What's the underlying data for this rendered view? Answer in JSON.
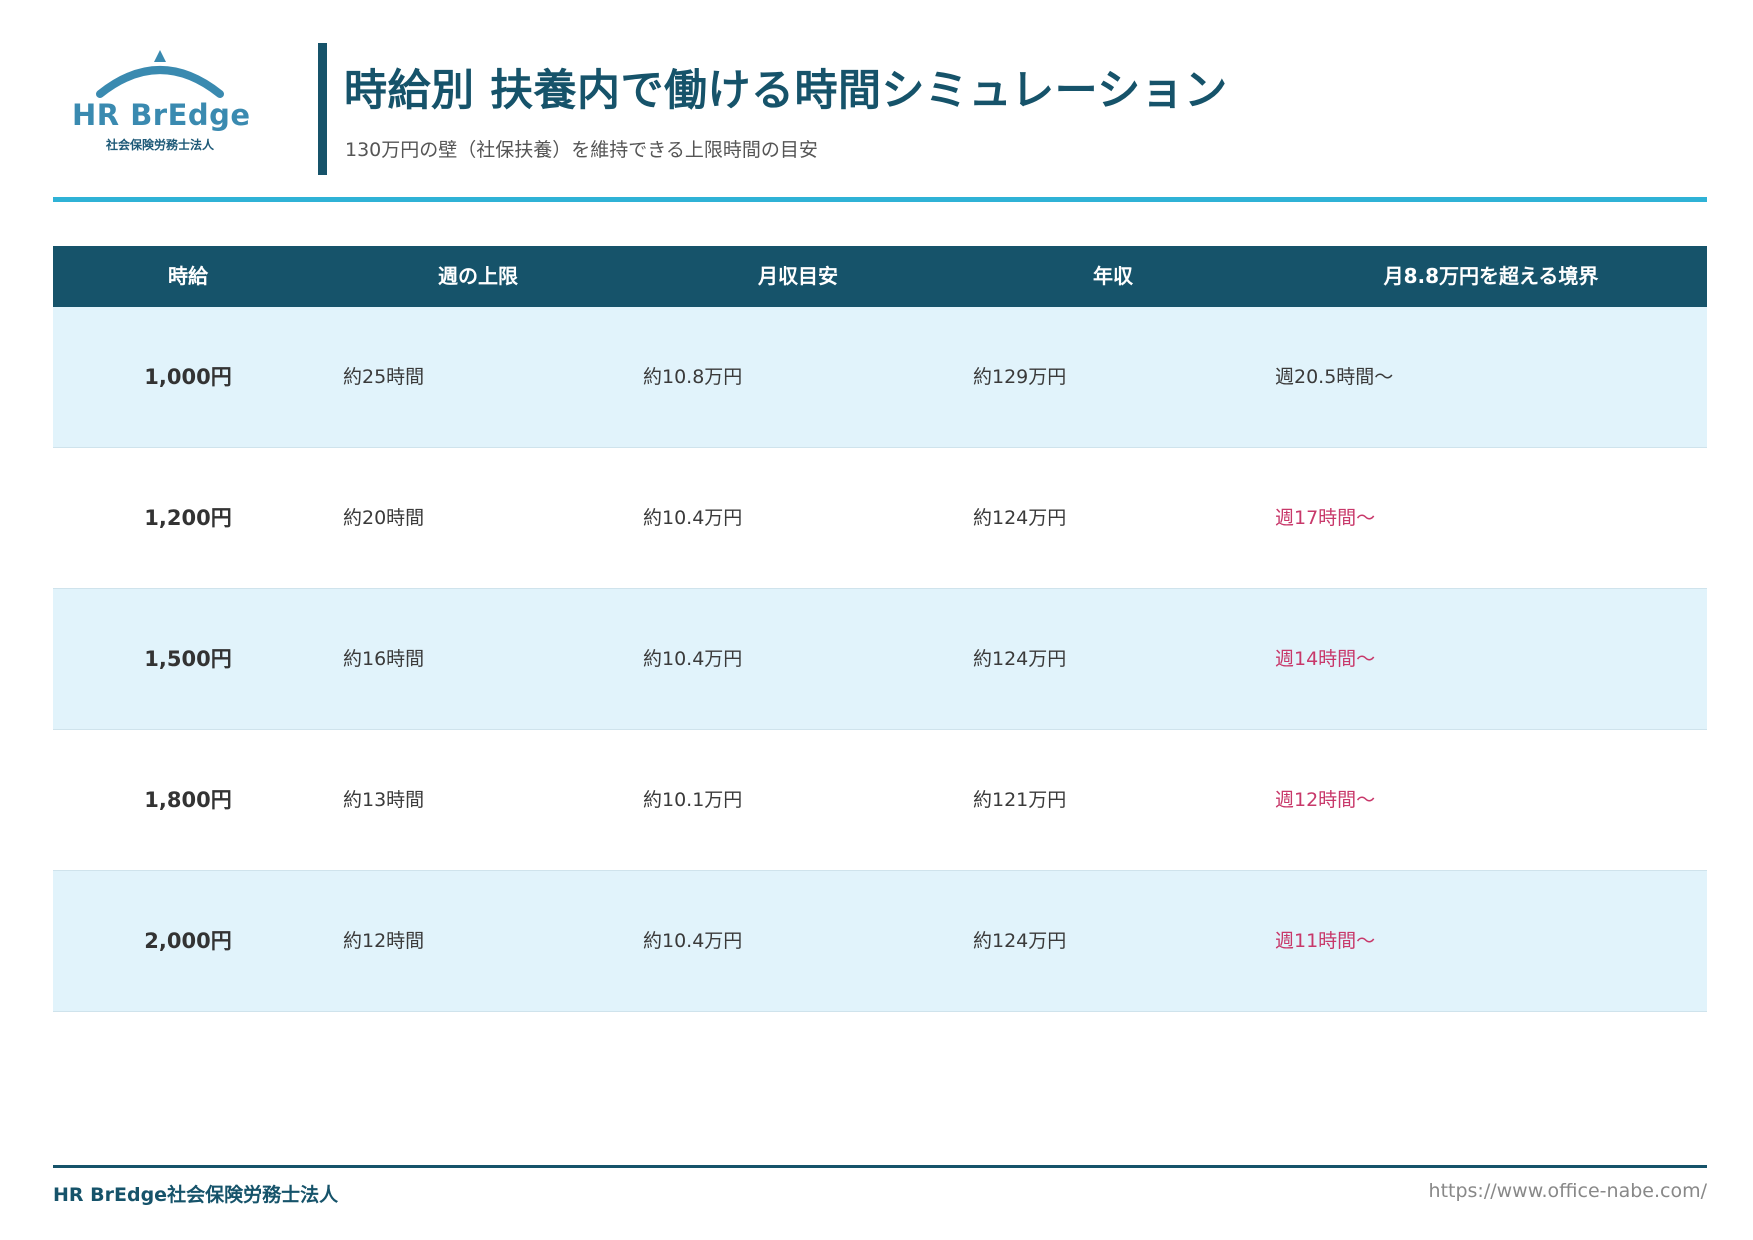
{
  "header": {
    "logo": {
      "name": "HR BrEdge",
      "subname": "社会保険労務士法人",
      "icon": "arch-roof-icon"
    },
    "title": "時給別 扶養内で働ける時間シミュレーション",
    "subtitle": "130万円の壁（社保扶養）を維持できる上限時間の目安"
  },
  "table": {
    "columns": [
      "時給",
      "週の上限",
      "月収目安",
      "年収",
      "月8.8万円を超える境界"
    ],
    "rows": [
      {
        "wage": "1,000円",
        "weekly_limit": "約25時間",
        "monthly": "約10.8万円",
        "annual": "約129万円",
        "border": "週20.5時間〜",
        "border_alert": false
      },
      {
        "wage": "1,200円",
        "weekly_limit": "約20時間",
        "monthly": "約10.4万円",
        "annual": "約124万円",
        "border": "週17時間〜",
        "border_alert": true
      },
      {
        "wage": "1,500円",
        "weekly_limit": "約16時間",
        "monthly": "約10.4万円",
        "annual": "約124万円",
        "border": "週14時間〜",
        "border_alert": true
      },
      {
        "wage": "1,800円",
        "weekly_limit": "約13時間",
        "monthly": "約10.1万円",
        "annual": "約121万円",
        "border": "週12時間〜",
        "border_alert": true
      },
      {
        "wage": "2,000円",
        "weekly_limit": "約12時間",
        "monthly": "約10.4万円",
        "annual": "約124万円",
        "border": "週11時間〜",
        "border_alert": true
      }
    ]
  },
  "footer": {
    "company": "HR BrEdge社会保険労務士法人",
    "url": "https://www.office-nabe.com/"
  },
  "colors": {
    "primary": "#16536a",
    "accent": "#2fb2d6",
    "row_shade": "#e1f3fb",
    "alert": "#c8386a",
    "logo": "#3a8ab0"
  }
}
